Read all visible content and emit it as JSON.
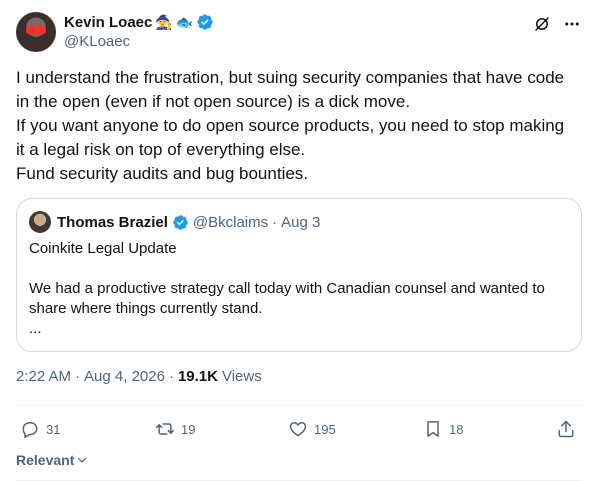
{
  "author": {
    "display_name": "Kevin Loaec",
    "emojis": [
      "🧙",
      "🐟"
    ],
    "handle": "@KLoaec",
    "verified": true
  },
  "tweet": {
    "lines": [
      "I understand the frustration, but suing security companies that have code in the open (even if not open source) is a dick move.",
      "If you want anyone to do open source products, you need to stop making it a legal risk on top of everything else.",
      "Fund security audits and bug bounties."
    ]
  },
  "quote": {
    "display_name": "Thomas Braziel",
    "handle": "@Bkclaims",
    "dot": "·",
    "date": "Aug 3",
    "lines": [
      "Coinkite Legal Update",
      "",
      "We had a productive strategy call today with Canadian counsel and wanted to share where things currently stand.",
      "..."
    ]
  },
  "meta": {
    "time": "2:22 AM",
    "sep1": "·",
    "date": "Aug 4, 2026",
    "sep2": "·",
    "views_count": "19.1K",
    "views_label": "Views"
  },
  "actions": {
    "replies": "31",
    "reposts": "19",
    "likes": "195",
    "bookmarks": "18"
  },
  "sort": {
    "label": "Relevant"
  },
  "colors": {
    "verified": "#1d9bf0",
    "muted": "#536471",
    "text": "#0f1419",
    "border": "#cfd9de"
  }
}
